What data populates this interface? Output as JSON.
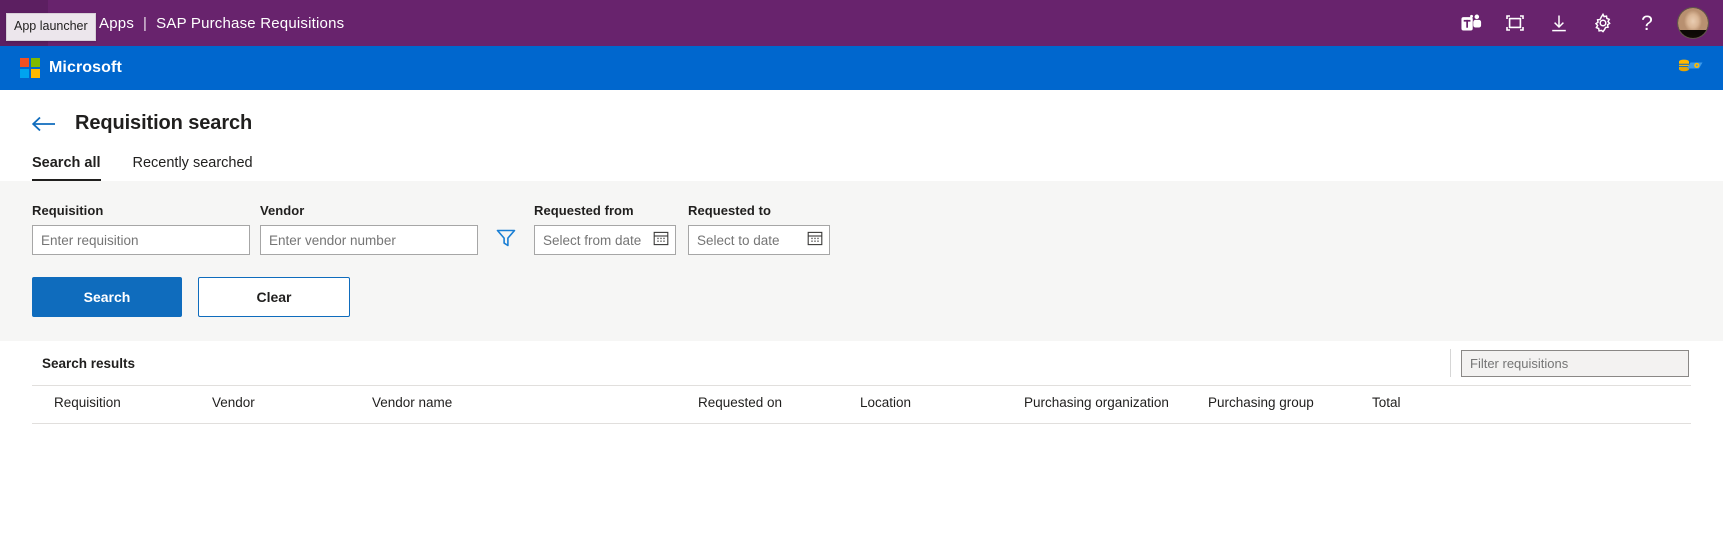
{
  "colors": {
    "suite_purple": "#68236D",
    "ms_blue": "#0067CE",
    "accent_blue": "#0f6cbd",
    "panel_grey": "#f6f6f5"
  },
  "suite_bar": {
    "app_launcher_label": "App launcher",
    "app_launcher_icon": "waffle-grid-icon",
    "suite_name": "Power Apps",
    "separator": "|",
    "app_title": "SAP Purchase Requisitions",
    "actions": [
      {
        "name": "teams-icon",
        "label": "Microsoft Teams"
      },
      {
        "name": "screen-capture-icon",
        "label": "Screen capture"
      },
      {
        "name": "download-icon",
        "label": "Download"
      },
      {
        "name": "gear-icon",
        "label": "Settings"
      },
      {
        "name": "help-icon",
        "label": "Help",
        "glyph": "?"
      }
    ],
    "avatar_label": "Account manager"
  },
  "ms_bar": {
    "logo_text": "Microsoft",
    "logo_icon": "microsoft-logo-icon",
    "logo_colors": [
      "#F25022",
      "#7FBA00",
      "#00A4EF",
      "#FFB900"
    ],
    "data_icon": "data-source-icon"
  },
  "page": {
    "back_icon": "back-arrow-icon",
    "title": "Requisition search"
  },
  "tabs": [
    {
      "label": "Search all",
      "active": true
    },
    {
      "label": "Recently searched",
      "active": false
    }
  ],
  "search_form": {
    "requisition": {
      "label": "Requisition",
      "placeholder": "Enter requisition",
      "value": ""
    },
    "vendor": {
      "label": "Vendor",
      "placeholder": "Enter vendor number",
      "value": ""
    },
    "filter_icon": "filter-funnel-icon",
    "requested_from": {
      "label": "Requested from",
      "placeholder": "Select from date",
      "value": "",
      "icon": "calendar-icon"
    },
    "requested_to": {
      "label": "Requested to",
      "placeholder": "Select to date",
      "value": "",
      "icon": "calendar-icon"
    },
    "search_button": "Search",
    "clear_button": "Clear"
  },
  "results": {
    "title": "Search results",
    "filter": {
      "placeholder": "Filter requisitions",
      "value": ""
    },
    "columns": [
      "Requisition",
      "Vendor",
      "Vendor name",
      "Requested on",
      "Location",
      "Purchasing organization",
      "Purchasing group",
      "Total"
    ],
    "rows": []
  }
}
